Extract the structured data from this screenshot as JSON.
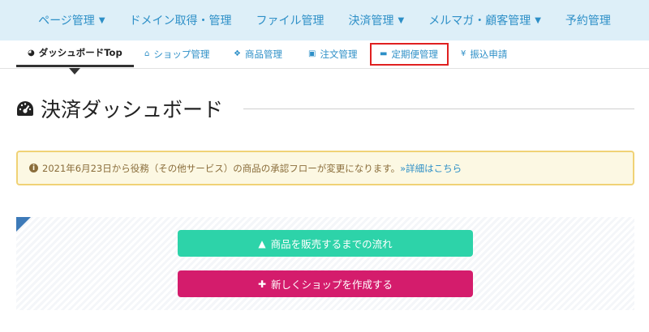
{
  "topnav": {
    "items": [
      {
        "label": "ページ管理",
        "has_dropdown": true
      },
      {
        "label": "ドメイン取得・管理",
        "has_dropdown": false
      },
      {
        "label": "ファイル管理",
        "has_dropdown": false
      },
      {
        "label": "決済管理",
        "has_dropdown": true
      },
      {
        "label": "メルマガ・顧客管理",
        "has_dropdown": true
      },
      {
        "label": "予約管理",
        "has_dropdown": false
      }
    ]
  },
  "subnav": {
    "items": [
      {
        "label": "ダッシュボードTop",
        "icon": "gauge-icon",
        "active": true
      },
      {
        "label": "ショップ管理",
        "icon": "home-icon"
      },
      {
        "label": "商品管理",
        "icon": "cubes-icon"
      },
      {
        "label": "注文管理",
        "icon": "cart-icon"
      },
      {
        "label": "定期便管理",
        "icon": "truck-icon",
        "highlighted": true
      },
      {
        "label": "振込申請",
        "icon": "yen-icon"
      }
    ]
  },
  "page": {
    "title": "決済ダッシュボード"
  },
  "alert": {
    "text": "2021年6月23日から役務（その他サービス）の商品の承認フローが変更になります。",
    "link_text": "»詳細はこちら"
  },
  "actions": {
    "flow_button": "商品を販売するまでの流れ",
    "create_shop_button": "新しくショップを作成する"
  },
  "colors": {
    "accent_blue": "#2d8fc7",
    "nav_bg": "#ddeff8",
    "green_button": "#2dd3a9",
    "pink_button": "#d41c6c",
    "highlight_red": "#e02020",
    "alert_bg": "#fcf8e3"
  }
}
